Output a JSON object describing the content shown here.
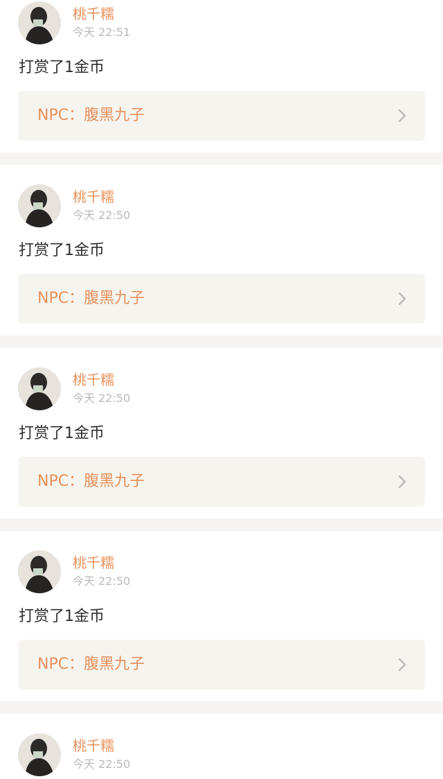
{
  "feed": {
    "items": [
      {
        "username": "桃千糯",
        "time": "今天 22:51",
        "message": "打赏了1金币",
        "npc_label": "NPC：腹黑九子",
        "avatar_icon": "user-avatar-icon",
        "chevron_icon": "chevron-right-icon"
      },
      {
        "username": "桃千糯",
        "time": "今天 22:50",
        "message": "打赏了1金币",
        "npc_label": "NPC：腹黑九子",
        "avatar_icon": "user-avatar-icon",
        "chevron_icon": "chevron-right-icon"
      },
      {
        "username": "桃千糯",
        "time": "今天 22:50",
        "message": "打赏了1金币",
        "npc_label": "NPC：腹黑九子",
        "avatar_icon": "user-avatar-icon",
        "chevron_icon": "chevron-right-icon"
      },
      {
        "username": "桃千糯",
        "time": "今天 22:50",
        "message": "打赏了1金币",
        "npc_label": "NPC：腹黑九子",
        "avatar_icon": "user-avatar-icon",
        "chevron_icon": "chevron-right-icon"
      },
      {
        "username": "桃千糯",
        "time": "今天 22:50"
      }
    ]
  },
  "colors": {
    "accent": "#e8905a",
    "timestamp": "#b9b9b9",
    "text": "#2f2f2f",
    "card_bg": "#f5f4ef",
    "separator": "#f5f4f3"
  }
}
